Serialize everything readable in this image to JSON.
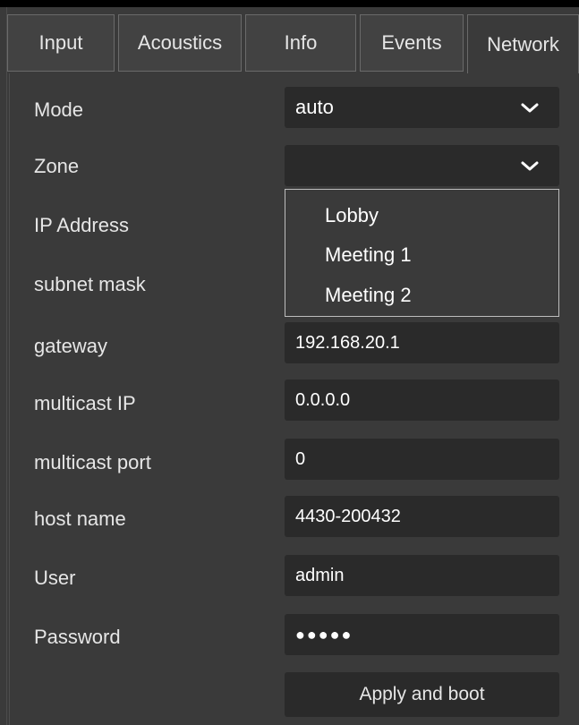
{
  "tabs": [
    {
      "label": "Input"
    },
    {
      "label": "Acoustics"
    },
    {
      "label": "Info"
    },
    {
      "label": "Events"
    },
    {
      "label": "Network",
      "active": true
    }
  ],
  "form": {
    "mode": {
      "label": "Mode",
      "value": "auto"
    },
    "zone": {
      "label": "Zone",
      "value": ""
    },
    "ip_address": {
      "label": "IP Address"
    },
    "subnet_mask": {
      "label": "subnet mask"
    },
    "gateway": {
      "label": "gateway",
      "value": "192.168.20.1"
    },
    "multicast_ip": {
      "label": "multicast IP",
      "value": "0.0.0.0"
    },
    "multicast_port": {
      "label": "multicast port",
      "value": "0"
    },
    "host_name": {
      "label": "host name",
      "value": "4430-200432"
    },
    "user": {
      "label": "User",
      "value": "admin"
    },
    "password": {
      "label": "Password",
      "value": "●●●●●"
    }
  },
  "zone_dropdown": {
    "options": [
      "Lobby",
      "Meeting 1",
      "Meeting 2"
    ]
  },
  "apply_button": {
    "label": "Apply and boot"
  },
  "icons": {
    "select_arrow": "chevron-down-icon"
  }
}
